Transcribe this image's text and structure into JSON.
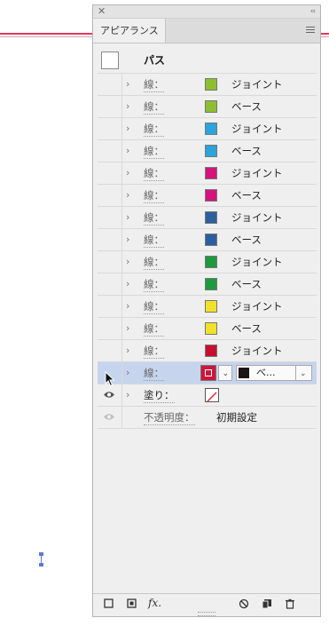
{
  "panel": {
    "tab_label": "アピアランス",
    "object_title": "パス"
  },
  "stroke_label": "線：",
  "fill_label": "塗り：",
  "opacity_label": "不透明度：",
  "opacity_value": "初期設定",
  "strokes": [
    {
      "color": "#8cbf2f",
      "value": "ジョイント"
    },
    {
      "color": "#8cbf2f",
      "value": "ベース"
    },
    {
      "color": "#2ba3dc",
      "value": "ジョイント"
    },
    {
      "color": "#2ba3dc",
      "value": "ベース"
    },
    {
      "color": "#d4147a",
      "value": "ジョイント"
    },
    {
      "color": "#d4147a",
      "value": "ベース"
    },
    {
      "color": "#2c5f9e",
      "value": "ジョイント"
    },
    {
      "color": "#2c5f9e",
      "value": "ベース"
    },
    {
      "color": "#1d9a3d",
      "value": "ジョイント"
    },
    {
      "color": "#1d9a3d",
      "value": "ベース"
    },
    {
      "color": "#f2e12b",
      "value": "ジョイント"
    },
    {
      "color": "#f2e12b",
      "value": "ベース"
    },
    {
      "color": "#c8102e",
      "value": "ジョイント"
    }
  ],
  "selected_stroke": {
    "label": "線：",
    "color": "#d1143a",
    "weight_text": "べ..."
  }
}
